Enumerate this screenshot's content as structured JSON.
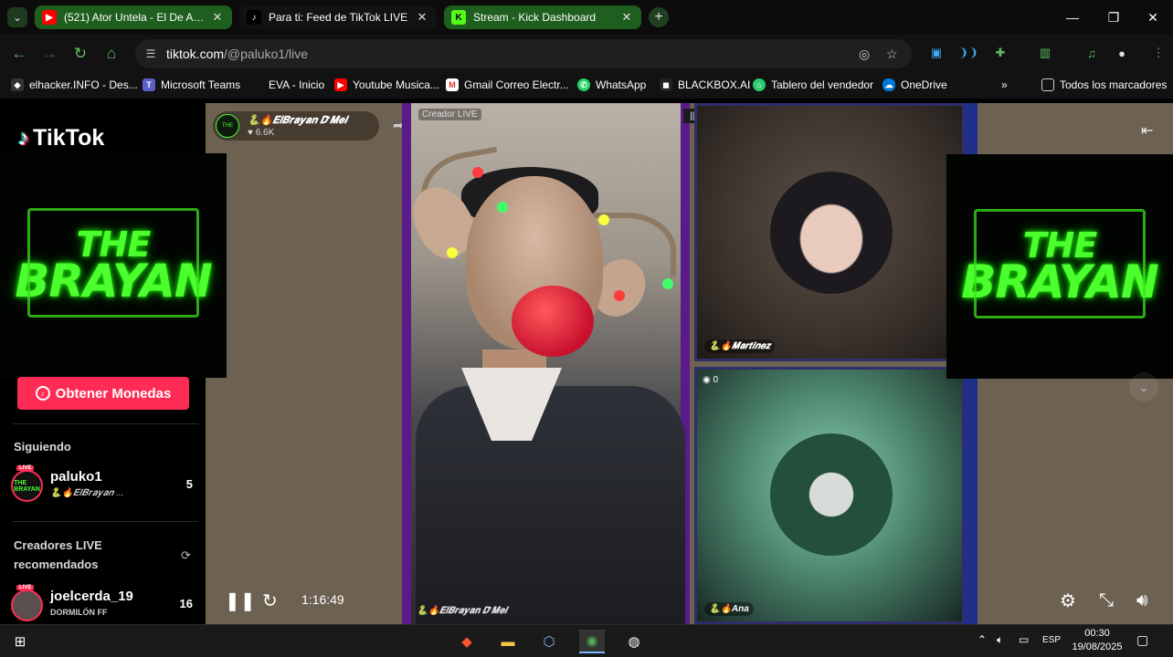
{
  "browser": {
    "tabs": [
      {
        "title": "(521) Ator Untela - El De Antes",
        "favicon": "youtube-icon"
      },
      {
        "title": "Para ti: Feed de TikTok LIVE",
        "favicon": "tiktok-icon"
      },
      {
        "title": "Stream - Kick Dashboard",
        "favicon": "kick-icon"
      }
    ],
    "url_host": "tiktok.com",
    "url_path": "/@paluko1/live",
    "bookmarks": [
      "elhacker.INFO - Des...",
      "Microsoft Teams",
      "EVA - Inicio",
      "Youtube Musica...",
      "Gmail Correo Electr...",
      "WhatsApp",
      "BLACKBOX.AI",
      "Tablero del vendedor",
      "OneDrive"
    ],
    "all_bookmarks": "Todos los marcadores",
    "colors": {
      "accent_green": "#5fbf5f",
      "tab_green": "#1e5e1e"
    }
  },
  "tiktok": {
    "logo_text": "TikTok",
    "banner_line1": "THE",
    "banner_line2": "BRAYAN",
    "coins_button": "Obtener Monedas",
    "following_title": "Siguiendo",
    "following": [
      {
        "name": "paluko1",
        "subtitle": "🐍🔥𝑬𝒍𝑩𝒓𝒂𝒚𝒂𝒏 ...",
        "count": "5"
      }
    ],
    "recommended_title_line1": "Creadores LIVE",
    "recommended_title_line2": "recomendados",
    "recommended": [
      {
        "name": "joelcerda_19",
        "subtitle": "DORMILÓN FF",
        "count": "16"
      }
    ],
    "live_badge": "LIVE",
    "brand_color": "#fe2c55"
  },
  "live": {
    "host_name": "🐍🔥𝑬𝒍𝑩𝒓𝒂𝒚𝒂𝒏 𝑫'𝑴𝒆𝒍",
    "host_likes": "♥ 6.6K",
    "creator_tag": "Creador LIVE",
    "main_label": "🐍🔥𝑬𝒍𝑩𝒓𝒂𝒚𝒂𝒏 𝑫'𝑴𝒆𝒍",
    "top_count": "0",
    "guests": [
      {
        "name": "🐍🔥𝑴𝒂𝒓𝒕𝒊𝒏𝒆𝒛",
        "count": ""
      },
      {
        "name": "🐍🔥Ana",
        "count": "0"
      }
    ],
    "elapsed": "1:16:49"
  },
  "taskbar": {
    "language": "ESP",
    "time": "00:30",
    "date": "19/08/2025"
  }
}
